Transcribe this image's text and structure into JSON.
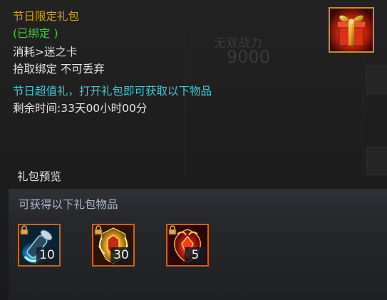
{
  "item": {
    "name": "节日限定礼包",
    "bind_status": "(已绑定 )",
    "consume": "消耗>迷之卡",
    "pickup_rule": "拾取绑定 不可丢弃",
    "description": "节日超值礼，打开礼包即可获取以下物品",
    "remaining_time": "剩余时间:33天00小时00分",
    "icon": "gift-box-icon"
  },
  "preview": {
    "title": "礼包预览",
    "subtitle": "可获得以下礼包物品",
    "items": [
      {
        "icon": "blue-scroll-icon",
        "count": "10",
        "locked": true
      },
      {
        "icon": "golden-emblem-icon",
        "count": "30",
        "locked": true
      },
      {
        "icon": "red-crest-icon",
        "count": "5",
        "locked": true
      }
    ]
  },
  "background": {
    "faded_text_1": "无双战力",
    "faded_text_2": "9000"
  },
  "colors": {
    "name": "#d4a414",
    "bind_status": "#3fcf3f",
    "normal_text": "#e4e4e4",
    "description": "#43ccd6",
    "preview_subtitle": "#a9b8cb",
    "slot_border": "#c8661a"
  }
}
